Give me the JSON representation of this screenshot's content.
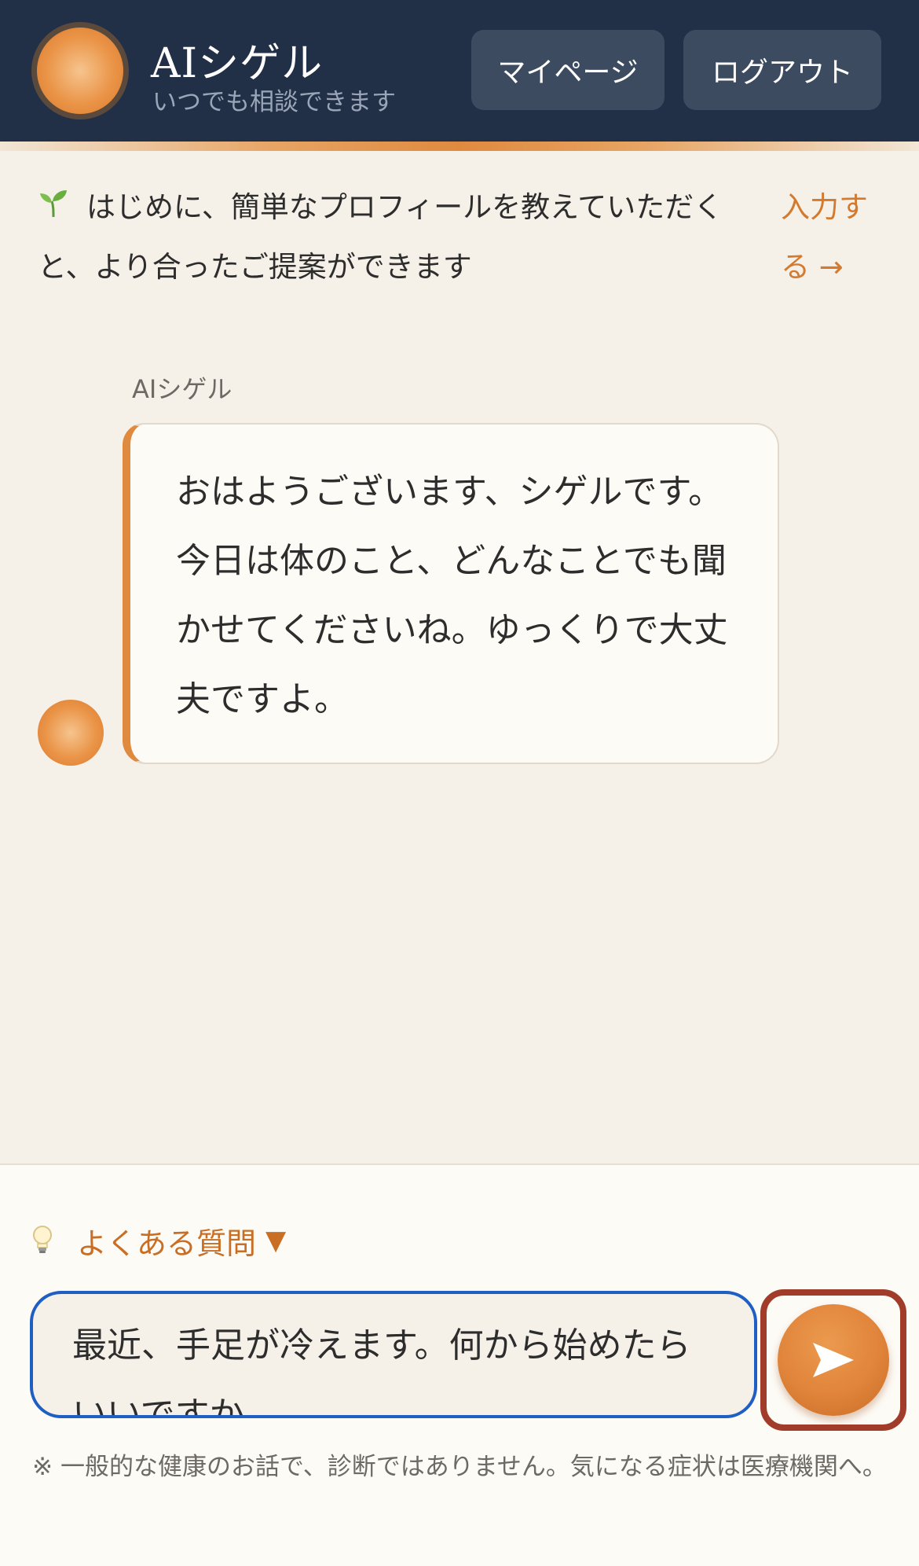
{
  "header": {
    "title": "AIシゲル",
    "subtitle": "いつでも相談できます",
    "mypage_label": "マイページ",
    "logout_label": "ログアウト"
  },
  "banner": {
    "icon": "sprout-icon",
    "text": "はじめに、簡単なプロフィールを教えていただくと、より合ったご提案ができます",
    "link_label": "入力する →"
  },
  "chat": {
    "messages": [
      {
        "sender": "AIシゲル",
        "text": "おはようございます、シゲルです。今日は体のこと、どんなことでも聞かせてくださいね。ゆっくりで大丈夫ですよ。"
      }
    ]
  },
  "composer": {
    "faq_label": "よくある質問",
    "faq_arrow": "▼",
    "input_value": "最近、手足が冷えます。何から始めたらいいですか",
    "send_icon": "send-arrow-icon",
    "disclaimer": "※ 一般的な健康のお話で、診断ではありません。気になる症状は医療機関へ。"
  },
  "colors": {
    "header_bg": "#223047",
    "accent": "#e08a3f",
    "link": "#d37a2f",
    "input_border": "#1f5fc4",
    "send_border": "#a13c2a"
  }
}
